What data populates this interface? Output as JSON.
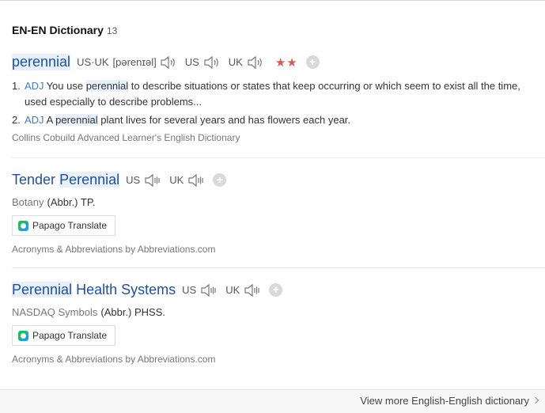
{
  "header": {
    "title": "EN-EN Dictionary",
    "count": "13"
  },
  "entries": [
    {
      "headword": "perennial",
      "pron_us_uk_label": "US·UK",
      "pron_ipa": "[pərenɪəl]",
      "us_label": "US",
      "uk_label": "UK",
      "stars": "★★",
      "senses": [
        {
          "num": "1.",
          "pos": "ADJ",
          "text_before": "You use ",
          "hl": "perennial",
          "text_after": " to describe situations or states that keep occurring or which seem to exist all the time, used especially to describe problems..."
        },
        {
          "num": "2.",
          "pos": "ADJ",
          "text_before": "A ",
          "hl": "perennial",
          "text_after": " plant lives for several years and has flowers each year."
        }
      ],
      "source": "Collins Cobuild Advanced Learner's English Dictionary"
    },
    {
      "headword_a": "Tender",
      "headword_b": "Perennial",
      "us_label": "US",
      "uk_label": "UK",
      "domain": "Botany",
      "value": "(Abbr.) TP.",
      "translate_label": "Papago Translate",
      "source": "Acronyms & Abbreviations by Abbreviations.com"
    },
    {
      "headword_a": "Perennial",
      "headword_b": "Health Systems",
      "us_label": "US",
      "uk_label": "UK",
      "domain": "NASDAQ Symbols",
      "value": "(Abbr.) PHSS.",
      "translate_label": "Papago Translate",
      "source": "Acronyms & Abbreviations by Abbreviations.com"
    }
  ],
  "footer": {
    "more_label": "View more English-English dictionary"
  },
  "colors": {
    "headword": "#1e50a2",
    "pos": "#3d7fc1",
    "stars": "#e2564b",
    "highlight": "#e8f1fb"
  },
  "icons": [
    "speaker-icon",
    "plus-icon",
    "papago-logo-icon",
    "chevron-right-icon"
  ]
}
